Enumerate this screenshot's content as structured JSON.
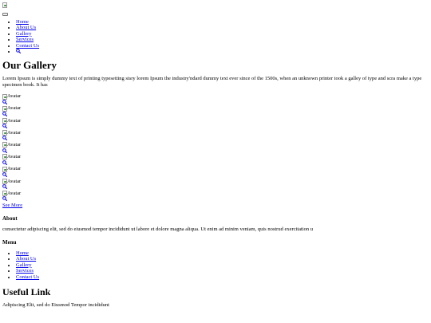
{
  "header": {
    "logo_alt": "",
    "nav": [
      "Home",
      "About Us",
      "Gallery",
      "Services",
      "Contact Us"
    ],
    "search_icon": "search-icon"
  },
  "gallery": {
    "title": "Our Gallery",
    "intro": "Lorem Ipsum is simply dummy text of printing typesetting stsry lorem Ipsum the industry'ndard dummy text ever since of the 1500s, when an unknown printer took a galley of type and scra make a type specimen book. It has",
    "item_alt": "Avatar",
    "item_count": 9,
    "see_more": "See More"
  },
  "about": {
    "title": "About",
    "text": "consectetur adipiscing elit, sed do eiusmod tempor incididunt ut labore et dolore magna aliqua. Ut enim ad minim veniam, quis nostrud exercitation u"
  },
  "menu": {
    "title": "Menu",
    "items": [
      "Home",
      "About Us",
      "Gallery",
      "Services",
      "Contact Us"
    ]
  },
  "useful": {
    "title": "Useful Link",
    "text": "Adipiscing Elit, sed do Eiusmod Tempor incididunt"
  },
  "colors": {
    "link": "#0000ee",
    "text": "#000000",
    "background": "#ffffff"
  }
}
